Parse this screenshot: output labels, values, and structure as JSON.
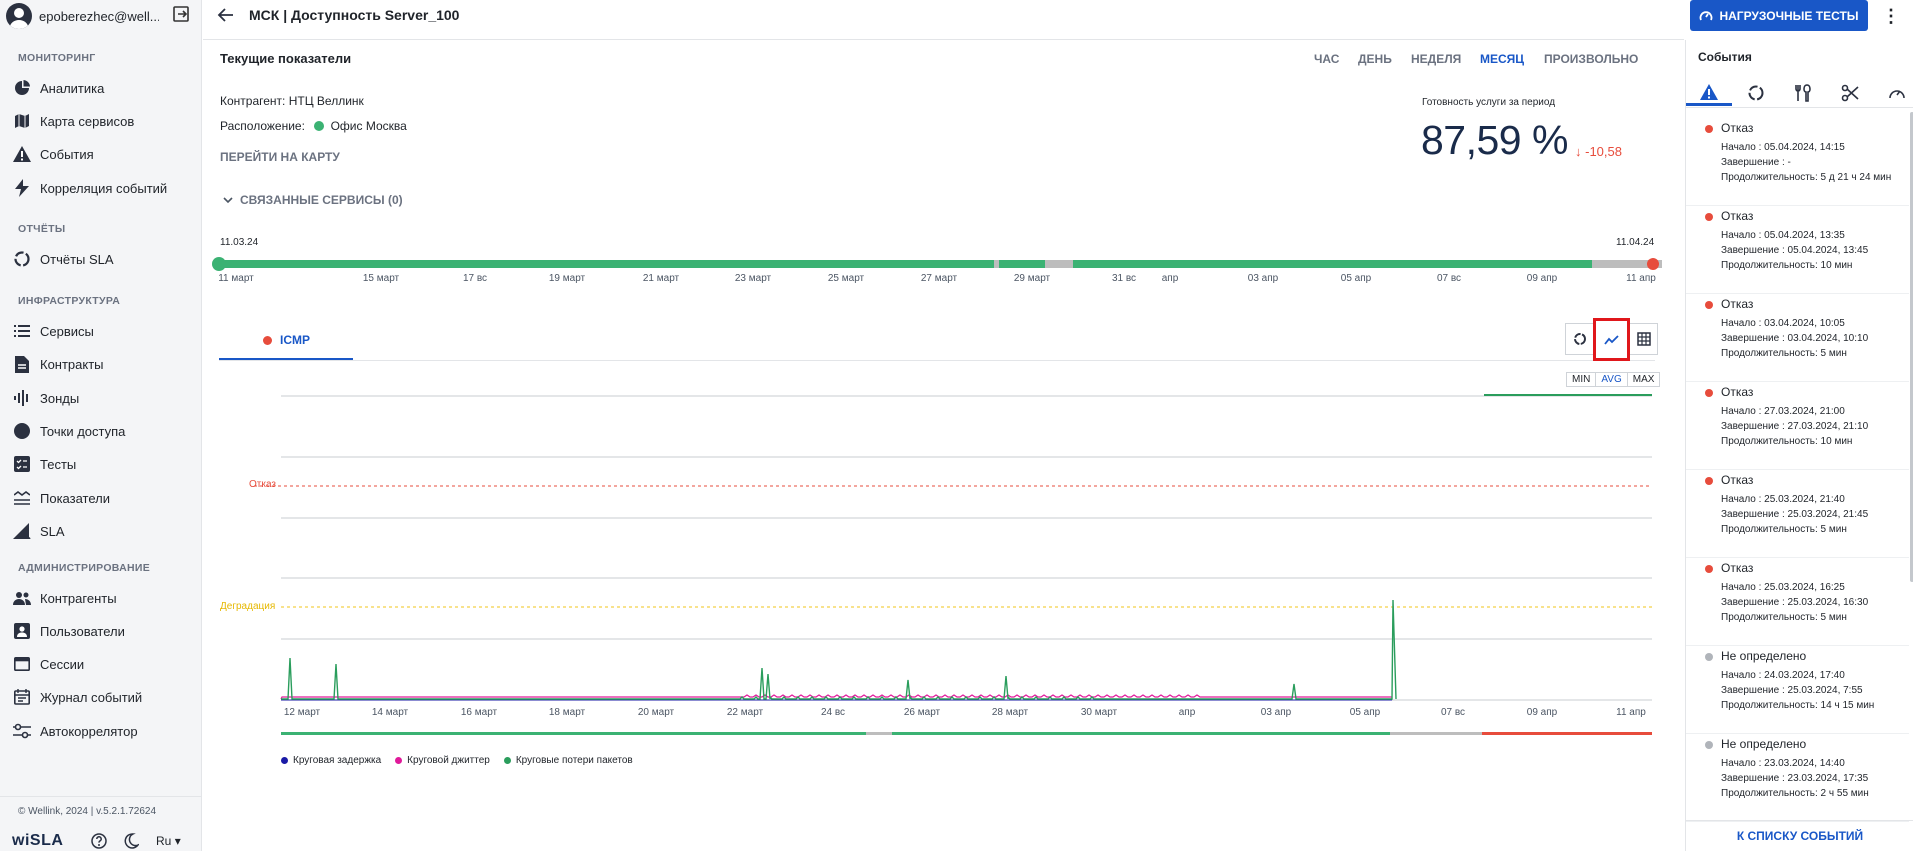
{
  "user": {
    "email": "epoberezhec@well..."
  },
  "sidebar": {
    "sections": {
      "monitoring": "МОНИТОРИНГ",
      "reports": "ОТЧЁТЫ",
      "infra": "ИНФРАСТРУКТУРА",
      "admin": "АДМИНИСТРИРОВАНИЕ"
    },
    "items": [
      {
        "label": "Аналитика",
        "icon": "pie-chart-icon"
      },
      {
        "label": "Карта сервисов",
        "icon": "map-icon"
      },
      {
        "label": "События",
        "icon": "warning-icon"
      },
      {
        "label": "Корреляция событий",
        "icon": "bolt-icon"
      },
      {
        "label": "Отчёты SLA",
        "icon": "refresh-icon"
      },
      {
        "label": "Сервисы",
        "icon": "list-icon"
      },
      {
        "label": "Контракты",
        "icon": "document-icon"
      },
      {
        "label": "Зонды",
        "icon": "signal-icon"
      },
      {
        "label": "Точки доступа",
        "icon": "circle-icon"
      },
      {
        "label": "Тесты",
        "icon": "checklist-icon"
      },
      {
        "label": "Показатели",
        "icon": "metrics-icon"
      },
      {
        "label": "SLA",
        "icon": "sla-icon"
      },
      {
        "label": "Контрагенты",
        "icon": "people-icon"
      },
      {
        "label": "Пользователи",
        "icon": "user-card-icon"
      },
      {
        "label": "Сессии",
        "icon": "window-icon"
      },
      {
        "label": "Журнал событий",
        "icon": "calendar-icon"
      },
      {
        "label": "Автокоррелятор",
        "icon": "sliders-icon"
      }
    ],
    "version": "© Wellink, 2024 | v.5.2.1.72624",
    "logo": "wiSLA",
    "lang": "Ru"
  },
  "header": {
    "title": "МСК | Доступность Server_100",
    "load_button": "НАГРУЗОЧНЫЕ ТЕСТЫ"
  },
  "main": {
    "heading": "Текущие показатели",
    "periods": [
      "ЧАС",
      "ДЕНЬ",
      "НЕДЕЛЯ",
      "МЕСЯЦ",
      "ПРОИЗВОЛЬНО"
    ],
    "active_period": "МЕСЯЦ",
    "contractor": "Контрагент: НТЦ Веллинк",
    "location_label": "Расположение:",
    "location": "Офис Москва",
    "map_link": "ПЕРЕЙТИ НА КАРТУ",
    "ready_label": "Готовность услуги за период",
    "ready_value": "87,59 %",
    "ready_delta": "↓ -10,58",
    "related": "СВЯЗАННЫЕ СЕРВИСЫ (0)",
    "timeline_start": "11.03.24",
    "timeline_end": "11.04.24",
    "timeline_ticks": [
      "11 март",
      "15 март",
      "17 вс",
      "19 март",
      "21 март",
      "23 март",
      "25 март",
      "27 март",
      "29 март",
      "31 вс",
      "апр",
      "03 апр",
      "05 апр",
      "07 вс",
      "09 апр",
      "11 апр"
    ],
    "tab": "ICMP",
    "minmaxavg": [
      "MIN",
      "AVG",
      "MAX"
    ],
    "fail_label": "Отказ",
    "degrade_label": "Деградация",
    "chart_ticks": [
      "12 март",
      "14 март",
      "16 март",
      "18 март",
      "20 март",
      "22 март",
      "24 вс",
      "26 март",
      "28 март",
      "30 март",
      "апр",
      "03 апр",
      "05 апр",
      "07 вс",
      "09 апр",
      "11 апр"
    ],
    "legend": [
      {
        "name": "Круговая задержка",
        "color": "#1a1aa6"
      },
      {
        "name": "Круговой джиттер",
        "color": "#e0199a"
      },
      {
        "name": "Круговые потери пакетов",
        "color": "#2a9d5c"
      }
    ]
  },
  "events_panel": {
    "title": "События",
    "events": [
      {
        "status": "Отказ",
        "color": "#e74c3c",
        "start": "Начало : 05.04.2024, 14:15",
        "end": "Завершение : -",
        "duration": "Продолжительность: 5 д 21 ч 24 мин"
      },
      {
        "status": "Отказ",
        "color": "#e74c3c",
        "start": "Начало : 05.04.2024, 13:35",
        "end": "Завершение : 05.04.2024, 13:45",
        "duration": "Продолжительность: 10 мин"
      },
      {
        "status": "Отказ",
        "color": "#e74c3c",
        "start": "Начало : 03.04.2024, 10:05",
        "end": "Завершение : 03.04.2024, 10:10",
        "duration": "Продолжительность: 5 мин"
      },
      {
        "status": "Отказ",
        "color": "#e74c3c",
        "start": "Начало : 27.03.2024, 21:00",
        "end": "Завершение : 27.03.2024, 21:10",
        "duration": "Продолжительность: 10 мин"
      },
      {
        "status": "Отказ",
        "color": "#e74c3c",
        "start": "Начало : 25.03.2024, 21:40",
        "end": "Завершение : 25.03.2024, 21:45",
        "duration": "Продолжительность: 5 мин"
      },
      {
        "status": "Отказ",
        "color": "#e74c3c",
        "start": "Начало : 25.03.2024, 16:25",
        "end": "Завершение : 25.03.2024, 16:30",
        "duration": "Продолжительность: 5 мин"
      },
      {
        "status": "Не определено",
        "color": "#b0b4ba",
        "start": "Начало : 24.03.2024, 17:40",
        "end": "Завершение : 25.03.2024, 7:55",
        "duration": "Продолжительность: 14 ч 15 мин"
      },
      {
        "status": "Не определено",
        "color": "#b0b4ba",
        "start": "Начало : 23.03.2024, 14:40",
        "end": "Завершение : 23.03.2024, 17:35",
        "duration": "Продолжительность: 2 ч 55 мин"
      }
    ],
    "footer": "К СПИСКУ СОБЫТИЙ"
  }
}
